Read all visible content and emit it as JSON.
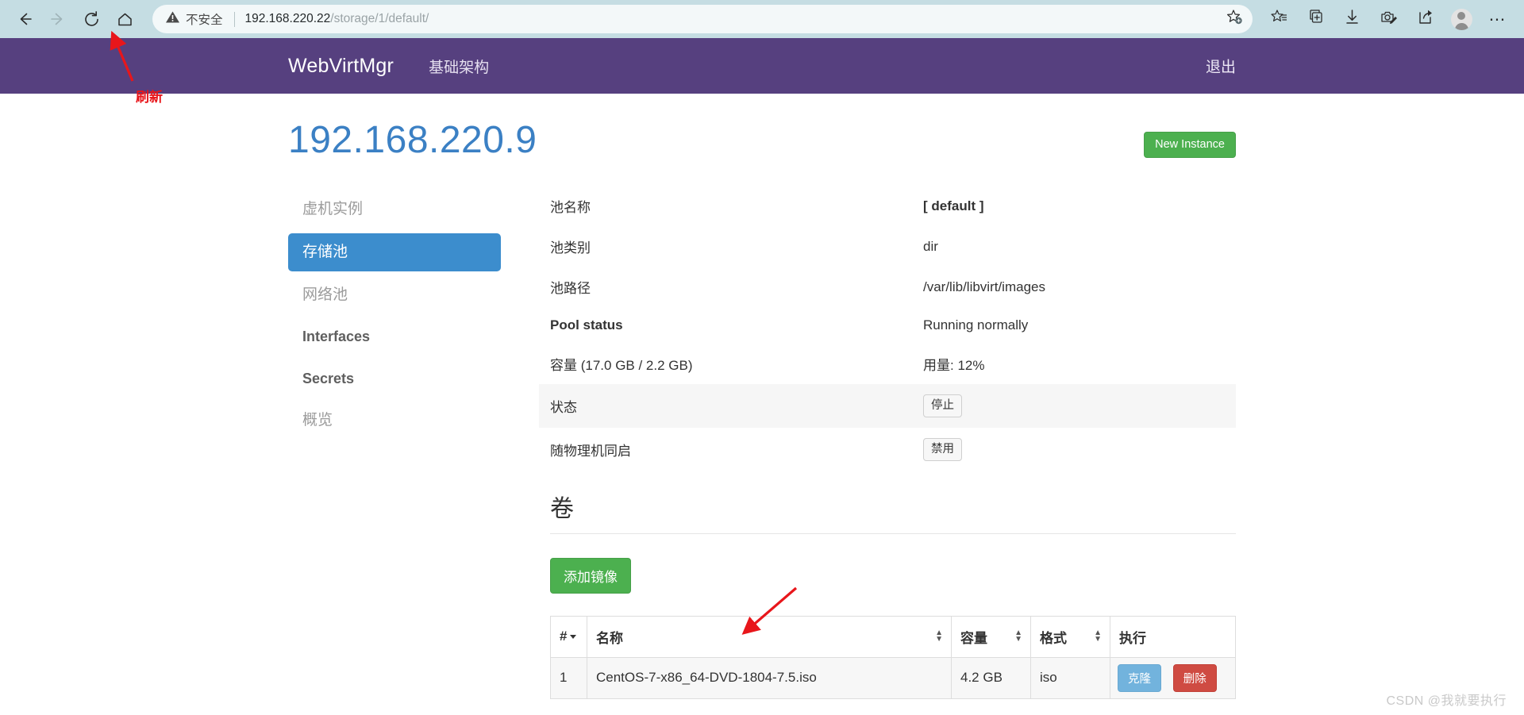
{
  "browser": {
    "back_icon": "back-arrow-icon",
    "forward_icon": "forward-arrow-icon",
    "reload_icon": "reload-icon",
    "home_icon": "home-icon",
    "security_label": "不安全",
    "url_host": "192.168.220.22",
    "url_path": "/storage/1/default/",
    "url_full": "192.168.220.22/storage/1/default/",
    "add_favorite_icon": "star-add-icon",
    "toolbar_icons": [
      "favorites-icon",
      "collections-icon",
      "downloads-icon",
      "screenshot-icon",
      "share-icon",
      "profile-avatar-icon",
      "settings-more-icon"
    ]
  },
  "navbar": {
    "brand": "WebVirtMgr",
    "link_infrastructure": "基础架构",
    "logout": "退出"
  },
  "header": {
    "title": "192.168.220.9",
    "new_instance_label": "New Instance"
  },
  "sidebar": {
    "items": [
      {
        "label": "虚机实例",
        "active": false,
        "latin": false
      },
      {
        "label": "存储池",
        "active": true,
        "latin": false
      },
      {
        "label": "网络池",
        "active": false,
        "latin": false
      },
      {
        "label": "Interfaces",
        "active": false,
        "latin": true
      },
      {
        "label": "Secrets",
        "active": false,
        "latin": true
      },
      {
        "label": "概览",
        "active": false,
        "latin": false
      }
    ]
  },
  "details": {
    "rows": [
      {
        "key": "池名称",
        "value": "[ default ]",
        "bold_key": false,
        "bold_value": true,
        "striped": false,
        "button": null
      },
      {
        "key": "池类别",
        "value": "dir",
        "bold_key": false,
        "bold_value": false,
        "striped": false,
        "button": null
      },
      {
        "key": "池路径",
        "value": "/var/lib/libvirt/images",
        "bold_key": false,
        "bold_value": false,
        "striped": false,
        "button": null
      },
      {
        "key": "Pool status",
        "value": "Running normally",
        "bold_key": true,
        "bold_value": false,
        "striped": false,
        "button": null
      },
      {
        "key": "容量 (17.0 GB / 2.2 GB)",
        "value": "用量: 12%",
        "bold_key": false,
        "bold_value": false,
        "striped": false,
        "button": null
      },
      {
        "key": "状态",
        "value": "",
        "bold_key": false,
        "bold_value": false,
        "striped": true,
        "button": "停止"
      },
      {
        "key": "随物理机同启",
        "value": "",
        "bold_key": false,
        "bold_value": false,
        "striped": false,
        "button": "禁用"
      }
    ]
  },
  "volumes": {
    "title": "卷",
    "add_image_label": "添加镜像",
    "columns": [
      {
        "label": "#",
        "sortable_caret": true,
        "sortable_updown": false
      },
      {
        "label": "名称",
        "sortable_caret": false,
        "sortable_updown": true
      },
      {
        "label": "容量",
        "sortable_caret": false,
        "sortable_updown": true
      },
      {
        "label": "格式",
        "sortable_caret": false,
        "sortable_updown": true
      },
      {
        "label": "执行",
        "sortable_caret": false,
        "sortable_updown": false
      }
    ],
    "rows": [
      {
        "index": "1",
        "name": "CentOS-7-x86_64-DVD-1804-7.5.iso",
        "size": "4.2 GB",
        "format": "iso",
        "clone_label": "克隆",
        "delete_label": "删除"
      }
    ]
  },
  "annotations": {
    "refresh_label": "刷新",
    "arrow_color": "#e8161b"
  },
  "watermark": "CSDN @我就要执行",
  "colors": {
    "navbar_purple": "#56407f",
    "title_blue": "#3b80c4",
    "sidebar_active_blue": "#3c8dcd",
    "green_button": "#4cb04f",
    "clone_blue": "#72b3dd",
    "delete_red": "#cf4b42",
    "browser_bar": "#c5dde3"
  }
}
